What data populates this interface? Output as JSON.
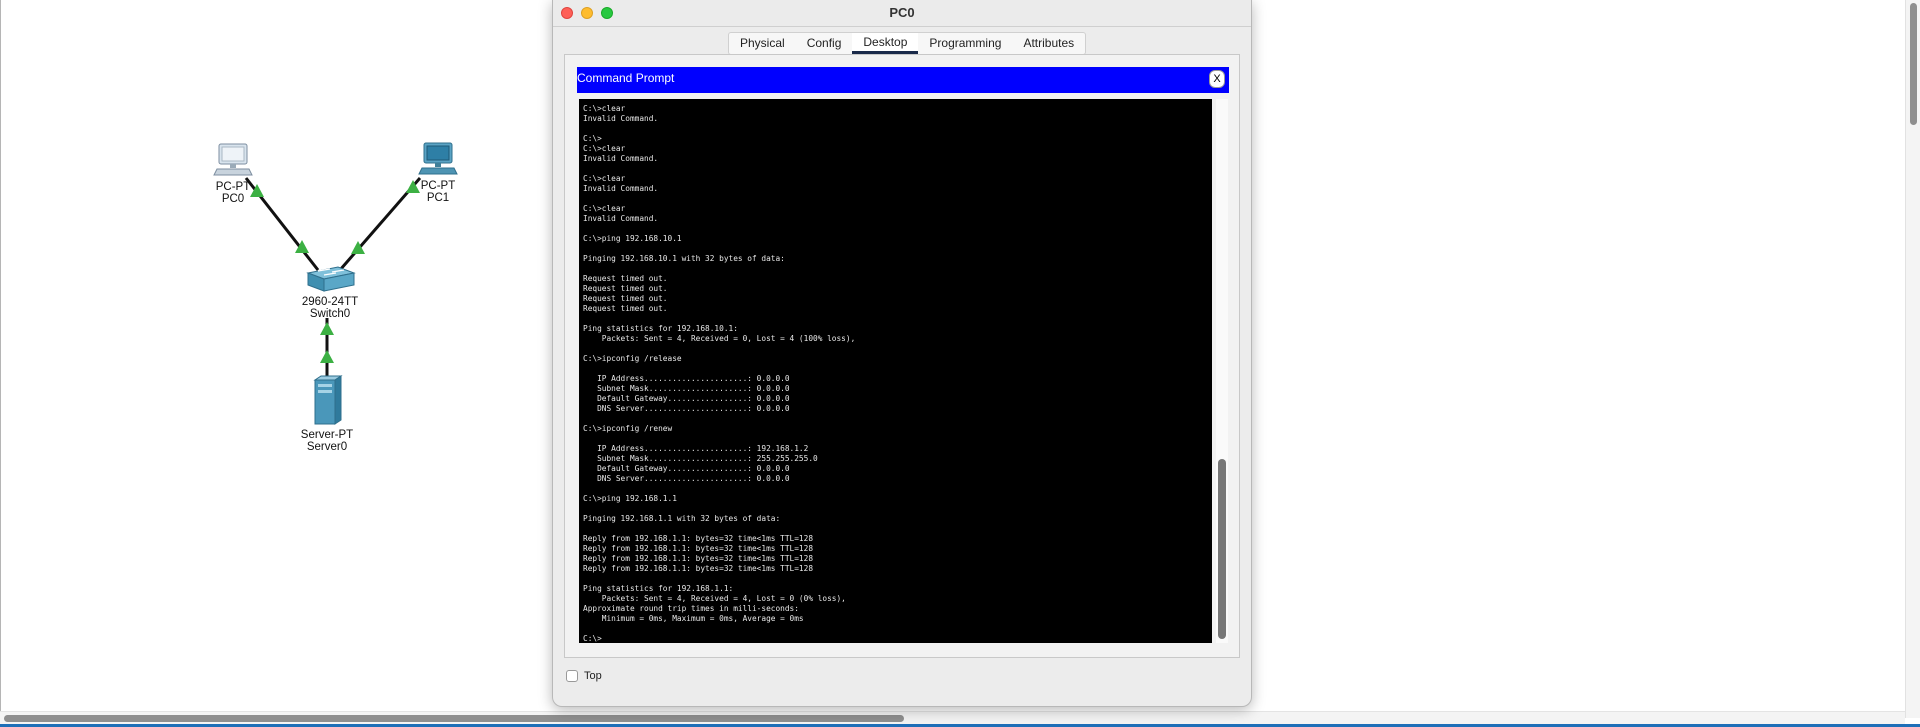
{
  "workspace": {
    "devices": [
      {
        "id": "pc0",
        "type": "PC-PT",
        "name": "PC0"
      },
      {
        "id": "pc1",
        "type": "PC-PT",
        "name": "PC1"
      },
      {
        "id": "switch0",
        "type": "2960-24TT",
        "name": "Switch0"
      },
      {
        "id": "server0",
        "type": "Server-PT",
        "name": "Server0"
      }
    ],
    "link_color": "#111111",
    "link_status_color": "#3cb043"
  },
  "window": {
    "title": "PC0",
    "tabs": [
      {
        "label": "Physical",
        "active": false
      },
      {
        "label": "Config",
        "active": false
      },
      {
        "label": "Desktop",
        "active": true
      },
      {
        "label": "Programming",
        "active": false
      },
      {
        "label": "Attributes",
        "active": false
      }
    ],
    "command_prompt": {
      "title": "Command Prompt",
      "close_label": "X",
      "header_color": "#0000ff",
      "output": "C:\\>clear\nInvalid Command.\n\nC:\\>\nC:\\>clear\nInvalid Command.\n\nC:\\>clear\nInvalid Command.\n\nC:\\>clear\nInvalid Command.\n\nC:\\>ping 192.168.10.1\n\nPinging 192.168.10.1 with 32 bytes of data:\n\nRequest timed out.\nRequest timed out.\nRequest timed out.\nRequest timed out.\n\nPing statistics for 192.168.10.1:\n    Packets: Sent = 4, Received = 0, Lost = 4 (100% loss),\n\nC:\\>ipconfig /release\n\n   IP Address......................: 0.0.0.0\n   Subnet Mask.....................: 0.0.0.0\n   Default Gateway.................: 0.0.0.0\n   DNS Server......................: 0.0.0.0\n\nC:\\>ipconfig /renew\n\n   IP Address......................: 192.168.1.2\n   Subnet Mask.....................: 255.255.255.0\n   Default Gateway.................: 0.0.0.0\n   DNS Server......................: 0.0.0.0\n\nC:\\>ping 192.168.1.1\n\nPinging 192.168.1.1 with 32 bytes of data:\n\nReply from 192.168.1.1: bytes=32 time<1ms TTL=128\nReply from 192.168.1.1: bytes=32 time<1ms TTL=128\nReply from 192.168.1.1: bytes=32 time<1ms TTL=128\nReply from 192.168.1.1: bytes=32 time<1ms TTL=128\n\nPing statistics for 192.168.1.1:\n    Packets: Sent = 4, Received = 4, Lost = 0 (0% loss),\nApproximate round trip times in milli-seconds:\n    Minimum = 0ms, Maximum = 0ms, Average = 0ms\n\nC:\\>"
    },
    "top_checkbox": {
      "label": "Top",
      "checked": false
    }
  }
}
